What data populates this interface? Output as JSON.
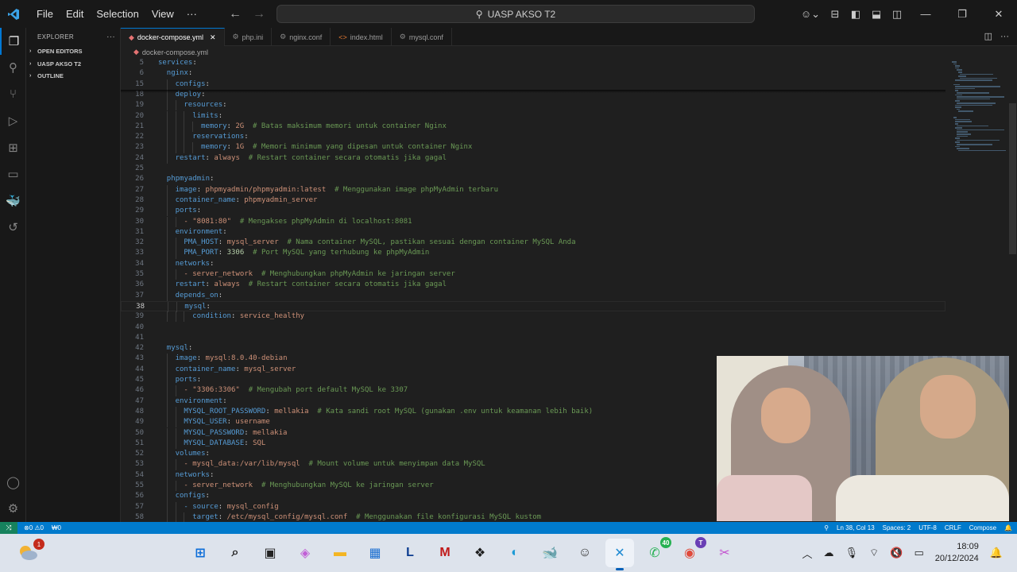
{
  "titlebar": {
    "menu": [
      "File",
      "Edit",
      "Selection",
      "View",
      "···"
    ],
    "search": "UASP AKSO T2"
  },
  "sidebar": {
    "title": "EXPLORER",
    "sections": [
      "OPEN EDITORS",
      "UASP AKSO T2",
      "OUTLINE"
    ]
  },
  "tabs": [
    {
      "label": "docker-compose.yml",
      "icon": "docker-icon",
      "active": true
    },
    {
      "label": "php.ini",
      "icon": "gear-icon",
      "active": false
    },
    {
      "label": "nginx.conf",
      "icon": "gear-icon",
      "active": false
    },
    {
      "label": "index.html",
      "icon": "html-icon",
      "active": false
    },
    {
      "label": "mysql.conf",
      "icon": "gear-icon",
      "active": false
    }
  ],
  "breadcrumb": "docker-compose.yml",
  "code": {
    "current_line": "38",
    "lines": [
      {
        "n": "5",
        "i": 0,
        "k": "services",
        "v": "",
        "c": ""
      },
      {
        "n": "6",
        "i": 1,
        "k": "nginx",
        "v": "",
        "c": ""
      },
      {
        "n": "15",
        "i": 2,
        "k": "configs",
        "v": "",
        "c": ""
      },
      {
        "n": "18",
        "i": 2,
        "k": "deploy",
        "v": "",
        "c": ""
      },
      {
        "n": "19",
        "i": 3,
        "k": "resources",
        "v": "",
        "c": ""
      },
      {
        "n": "20",
        "i": 4,
        "k": "limits",
        "v": "",
        "c": ""
      },
      {
        "n": "21",
        "i": 5,
        "k": "memory",
        "v": "2G",
        "c": "# Batas maksimum memori untuk container Nginx"
      },
      {
        "n": "22",
        "i": 4,
        "k": "reservations",
        "v": "",
        "c": ""
      },
      {
        "n": "23",
        "i": 5,
        "k": "memory",
        "v": "1G",
        "c": "# Memori minimum yang dipesan untuk container Nginx"
      },
      {
        "n": "24",
        "i": 2,
        "k": "restart",
        "v": "always",
        "c": "# Restart container secara otomatis jika gagal"
      },
      {
        "n": "25",
        "i": 0,
        "k": "",
        "v": "",
        "c": ""
      },
      {
        "n": "26",
        "i": 1,
        "k": "phpmyadmin",
        "v": "",
        "c": ""
      },
      {
        "n": "27",
        "i": 2,
        "k": "image",
        "v": "phpmyadmin/phpmyadmin:latest",
        "c": "# Menggunakan image phpMyAdmin terbaru"
      },
      {
        "n": "28",
        "i": 2,
        "k": "container_name",
        "v": "phpmyadmin_server",
        "c": ""
      },
      {
        "n": "29",
        "i": 2,
        "k": "ports",
        "v": "",
        "c": ""
      },
      {
        "n": "30",
        "i": 3,
        "k": "- \"8081:80\"",
        "v": "",
        "c": "# Mengakses phpMyAdmin di localhost:8081",
        "list": true
      },
      {
        "n": "31",
        "i": 2,
        "k": "environment",
        "v": "",
        "c": ""
      },
      {
        "n": "32",
        "i": 3,
        "k": "PMA_HOST",
        "v": "mysql_server",
        "c": "# Nama container MySQL, pastikan sesuai dengan container MySQL Anda"
      },
      {
        "n": "33",
        "i": 3,
        "k": "PMA_PORT",
        "v": "3306",
        "c": "# Port MySQL yang terhubung ke phpMyAdmin",
        "num": true
      },
      {
        "n": "34",
        "i": 2,
        "k": "networks",
        "v": "",
        "c": ""
      },
      {
        "n": "35",
        "i": 3,
        "k": "- server_network",
        "v": "",
        "c": "# Menghubungkan phpMyAdmin ke jaringan server",
        "list": true
      },
      {
        "n": "36",
        "i": 2,
        "k": "restart",
        "v": "always",
        "c": "# Restart container secara otomatis jika gagal"
      },
      {
        "n": "37",
        "i": 2,
        "k": "depends_on",
        "v": "",
        "c": ""
      },
      {
        "n": "38",
        "i": 3,
        "k": "mysql",
        "v": "",
        "c": ""
      },
      {
        "n": "39",
        "i": 4,
        "k": "condition",
        "v": "service_healthy",
        "c": ""
      },
      {
        "n": "40",
        "i": 0,
        "k": "",
        "v": "",
        "c": ""
      },
      {
        "n": "41",
        "i": 0,
        "k": "",
        "v": "",
        "c": ""
      },
      {
        "n": "42",
        "i": 1,
        "k": "mysql",
        "v": "",
        "c": ""
      },
      {
        "n": "43",
        "i": 2,
        "k": "image",
        "v": "mysql:8.0.40-debian",
        "c": ""
      },
      {
        "n": "44",
        "i": 2,
        "k": "container_name",
        "v": "mysql_server",
        "c": ""
      },
      {
        "n": "45",
        "i": 2,
        "k": "ports",
        "v": "",
        "c": ""
      },
      {
        "n": "46",
        "i": 3,
        "k": "- \"3306:3306\"",
        "v": "",
        "c": "# Mengubah port default MySQL ke 3307",
        "list": true
      },
      {
        "n": "47",
        "i": 2,
        "k": "environment",
        "v": "",
        "c": ""
      },
      {
        "n": "48",
        "i": 3,
        "k": "MYSQL_ROOT_PASSWORD",
        "v": "mellakia",
        "c": "# Kata sandi root MySQL (gunakan .env untuk keamanan lebih baik)"
      },
      {
        "n": "49",
        "i": 3,
        "k": "MYSQL_USER",
        "v": "username",
        "c": ""
      },
      {
        "n": "50",
        "i": 3,
        "k": "MYSQL_PASSWORD",
        "v": "mellakia",
        "c": ""
      },
      {
        "n": "51",
        "i": 3,
        "k": "MYSQL_DATABASE",
        "v": "SQL",
        "c": ""
      },
      {
        "n": "52",
        "i": 2,
        "k": "volumes",
        "v": "",
        "c": ""
      },
      {
        "n": "53",
        "i": 3,
        "k": "- mysql_data:/var/lib/mysql",
        "v": "",
        "c": "# Mount volume untuk menyimpan data MySQL",
        "list": true
      },
      {
        "n": "54",
        "i": 2,
        "k": "networks",
        "v": "",
        "c": ""
      },
      {
        "n": "55",
        "i": 3,
        "k": "- server_network",
        "v": "",
        "c": "# Menghubungkan MySQL ke jaringan server",
        "list": true
      },
      {
        "n": "56",
        "i": 2,
        "k": "configs",
        "v": "",
        "c": ""
      },
      {
        "n": "57",
        "i": 3,
        "k": "- source",
        "v": "mysql_config",
        "c": "",
        "list": true
      },
      {
        "n": "58",
        "i": 4,
        "k": "target",
        "v": "/etc/mysql_config/mysql.conf",
        "c": "# Menggunakan file konfigurasi MySQL kustom"
      }
    ]
  },
  "statusbar": {
    "errors": "⊗0 ⚠0",
    "ports": "₩0",
    "position": "Ln 38, Col 13",
    "spaces": "Spaces: 2",
    "encoding": "UTF-8",
    "eol": "CRLF",
    "language": "Compose"
  },
  "taskbar": {
    "weather_badge": "1",
    "apps": [
      {
        "name": "windows-start-icon",
        "glyph": "⊞",
        "color": "#0a6cd8"
      },
      {
        "name": "search-icon",
        "glyph": "⌕",
        "color": "#222222"
      },
      {
        "name": "task-view-icon",
        "glyph": "▣",
        "color": "#222222"
      },
      {
        "name": "copilot-icon",
        "glyph": "◈",
        "color": "#c15fd6"
      },
      {
        "name": "file-explorer-icon",
        "glyph": "▬",
        "color": "#f4b521"
      },
      {
        "name": "microsoft-store-icon",
        "glyph": "▦",
        "color": "#1b6fd1"
      },
      {
        "name": "l-app-icon",
        "glyph": "L",
        "color": "#0b3b8f"
      },
      {
        "name": "mcafee-icon",
        "glyph": "M",
        "color": "#c01818"
      },
      {
        "name": "dropbox-icon",
        "glyph": "❖",
        "color": "#1d1d1d"
      },
      {
        "name": "edge-icon",
        "glyph": "◐",
        "color": "#1d9bd6"
      },
      {
        "name": "docker-icon",
        "glyph": "🐋",
        "color": "#2496ed"
      },
      {
        "name": "steam-like-icon",
        "glyph": "☺",
        "color": "#333333"
      },
      {
        "name": "vscode-icon",
        "glyph": "✕",
        "color": "#1f8ad2",
        "active": true
      },
      {
        "name": "whatsapp-icon",
        "glyph": "✆",
        "color": "#25b152",
        "badge": "40"
      },
      {
        "name": "chrome-icon",
        "glyph": "◉",
        "color": "#e04a3b",
        "badge": "T"
      },
      {
        "name": "snipping-tool-icon",
        "glyph": "✂",
        "color": "#c34fcf"
      }
    ],
    "time": "18:09",
    "date": "20/12/2024"
  }
}
